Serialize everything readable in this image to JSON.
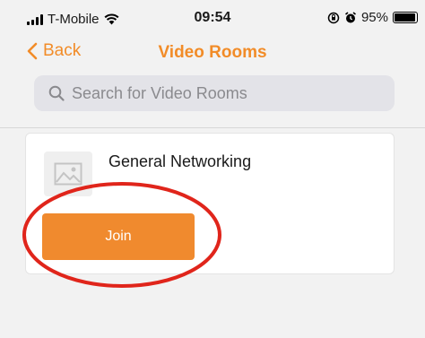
{
  "status_bar": {
    "carrier": "T-Mobile",
    "time": "09:54",
    "battery": "95%",
    "battery_level": 0.95
  },
  "nav": {
    "back_label": "Back",
    "title": "Video Rooms"
  },
  "search": {
    "placeholder": "Search for Video Rooms"
  },
  "rooms": [
    {
      "name": "General Networking",
      "join_label": "Join"
    }
  ],
  "colors": {
    "accent": "#f28c28",
    "button": "#f08a2e",
    "annotation": "#e0251b"
  }
}
